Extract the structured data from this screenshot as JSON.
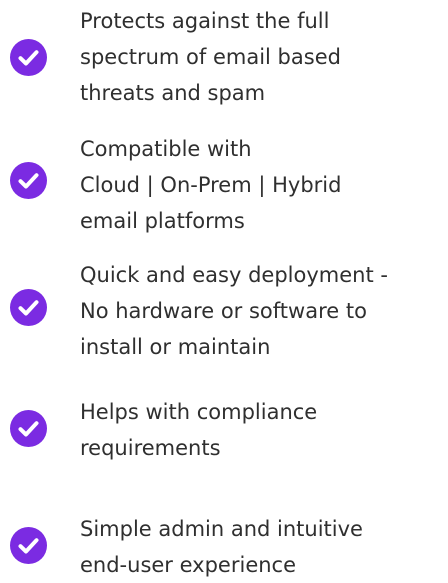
{
  "accent_color": "#7b2be2",
  "icon": "check-circle-icon",
  "features": [
    {
      "lines": [
        "Protects against the full",
        "spectrum of email based",
        "threats and spam"
      ]
    },
    {
      "lines": [
        "Compatible with",
        "Cloud | On-Prem | Hybrid",
        "email platforms"
      ]
    },
    {
      "lines": [
        "Quick and easy deployment -",
        "No hardware or software to",
        "install or maintain"
      ]
    },
    {
      "lines": [
        "Helps with compliance",
        "requirements"
      ]
    },
    {
      "lines": [
        "Simple admin and intuitive",
        "end-user experience"
      ]
    }
  ]
}
